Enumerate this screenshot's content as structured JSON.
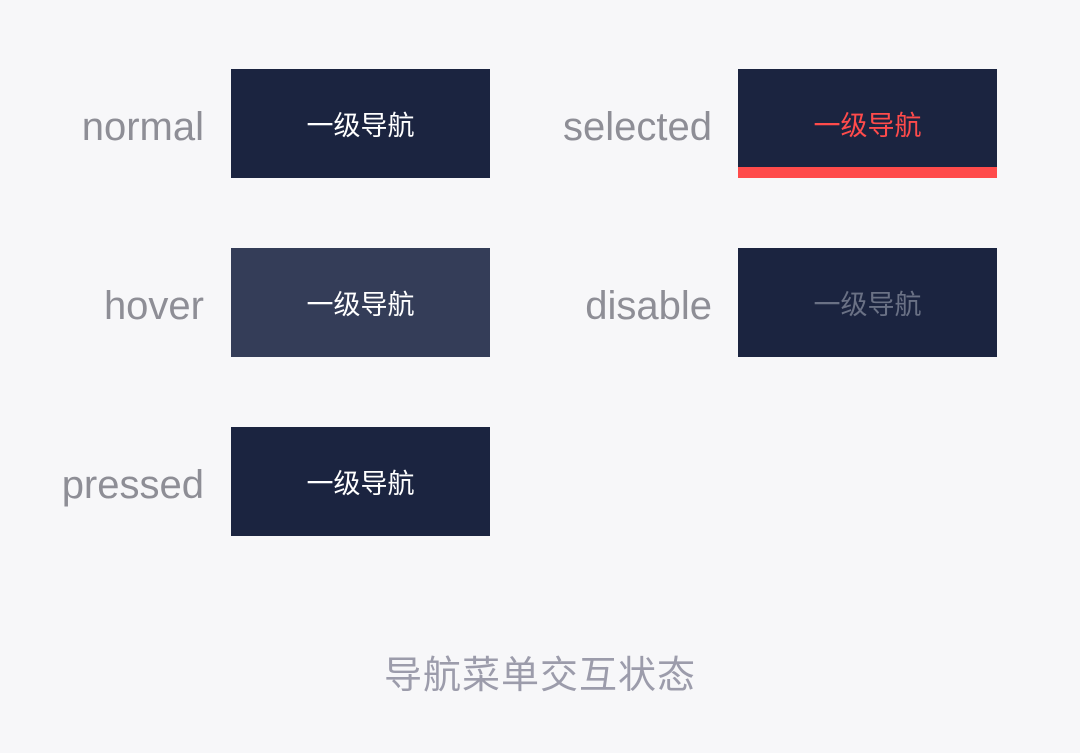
{
  "states": [
    {
      "key": "normal",
      "label": "normal",
      "button_text": "一级导航"
    },
    {
      "key": "selected",
      "label": "selected",
      "button_text": "一级导航"
    },
    {
      "key": "hover",
      "label": "hover",
      "button_text": "一级导航"
    },
    {
      "key": "disable",
      "label": "disable",
      "button_text": "一级导航"
    },
    {
      "key": "pressed",
      "label": "pressed",
      "button_text": "一级导航"
    }
  ],
  "colors": {
    "background": "#f7f7f9",
    "nav_default": "#1b2440",
    "nav_hover": "#343d58",
    "selected_accent": "#ff4b4b",
    "disabled_text": "#6a7185",
    "label_text": "#8e8e96"
  },
  "caption": "导航菜单交互状态"
}
